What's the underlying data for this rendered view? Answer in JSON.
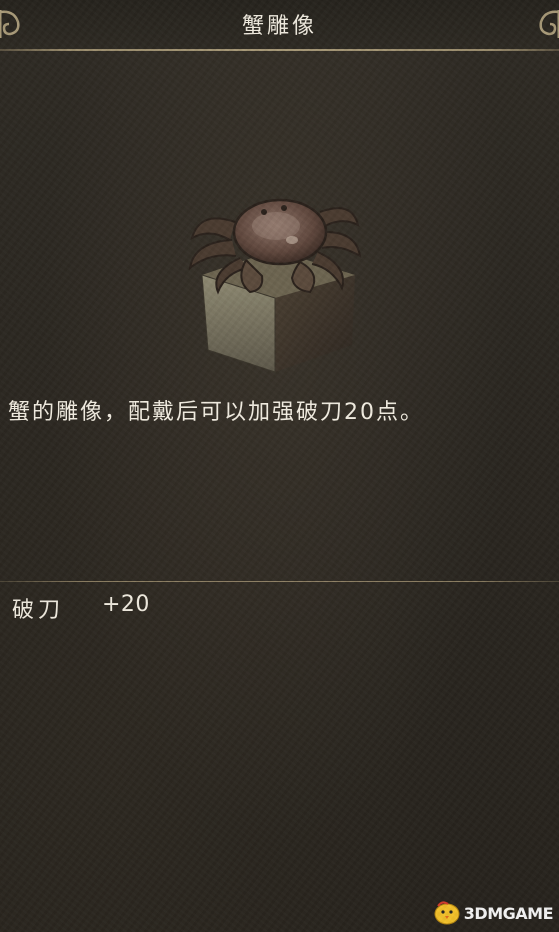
{
  "header": {
    "title": "蟹雕像"
  },
  "item": {
    "icon": "crab-statue-icon",
    "description": "蟹的雕像，配戴后可以加强破刀20点。"
  },
  "stats": [
    {
      "name": "破刀",
      "value": "+20"
    }
  ],
  "watermark": {
    "text": "3DMGAME",
    "icon": "mascot-chick-icon"
  },
  "colors": {
    "background": "#2b2822",
    "rule": "#a89a78",
    "text": "#f1ece0"
  }
}
